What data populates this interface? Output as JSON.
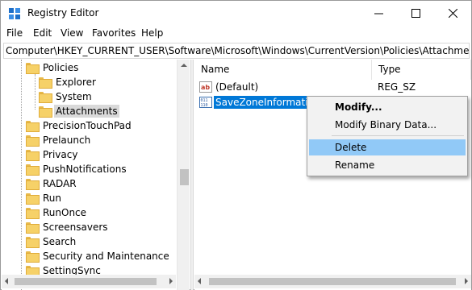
{
  "window": {
    "title": "Registry Editor"
  },
  "menu": [
    "File",
    "Edit",
    "View",
    "Favorites",
    "Help"
  ],
  "address": "Computer\\HKEY_CURRENT_USER\\Software\\Microsoft\\Windows\\CurrentVersion\\Policies\\Attachments",
  "tree": {
    "policies": "Policies",
    "explorer": "Explorer",
    "system": "System",
    "attachments": "Attachments",
    "items": [
      "PrecisionTouchPad",
      "Prelaunch",
      "Privacy",
      "PushNotifications",
      "RADAR",
      "Run",
      "RunOnce",
      "Screensavers",
      "Search",
      "Security and Maintenance",
      "SettingSync"
    ]
  },
  "list": {
    "col_name": "Name",
    "col_type": "Type",
    "rows": [
      {
        "name": "(Default)",
        "type": "REG_SZ",
        "icon": "string-value-icon"
      },
      {
        "name": "SaveZoneInformation",
        "type": "",
        "icon": "binary-value-icon"
      }
    ]
  },
  "context_menu": {
    "items": [
      "Modify...",
      "Modify Binary Data...",
      "Delete",
      "Rename"
    ],
    "highlighted": "Delete"
  },
  "colors": {
    "selection": "#0078d7",
    "menu_hover": "#91c9f7",
    "folder": "#f6d168"
  }
}
